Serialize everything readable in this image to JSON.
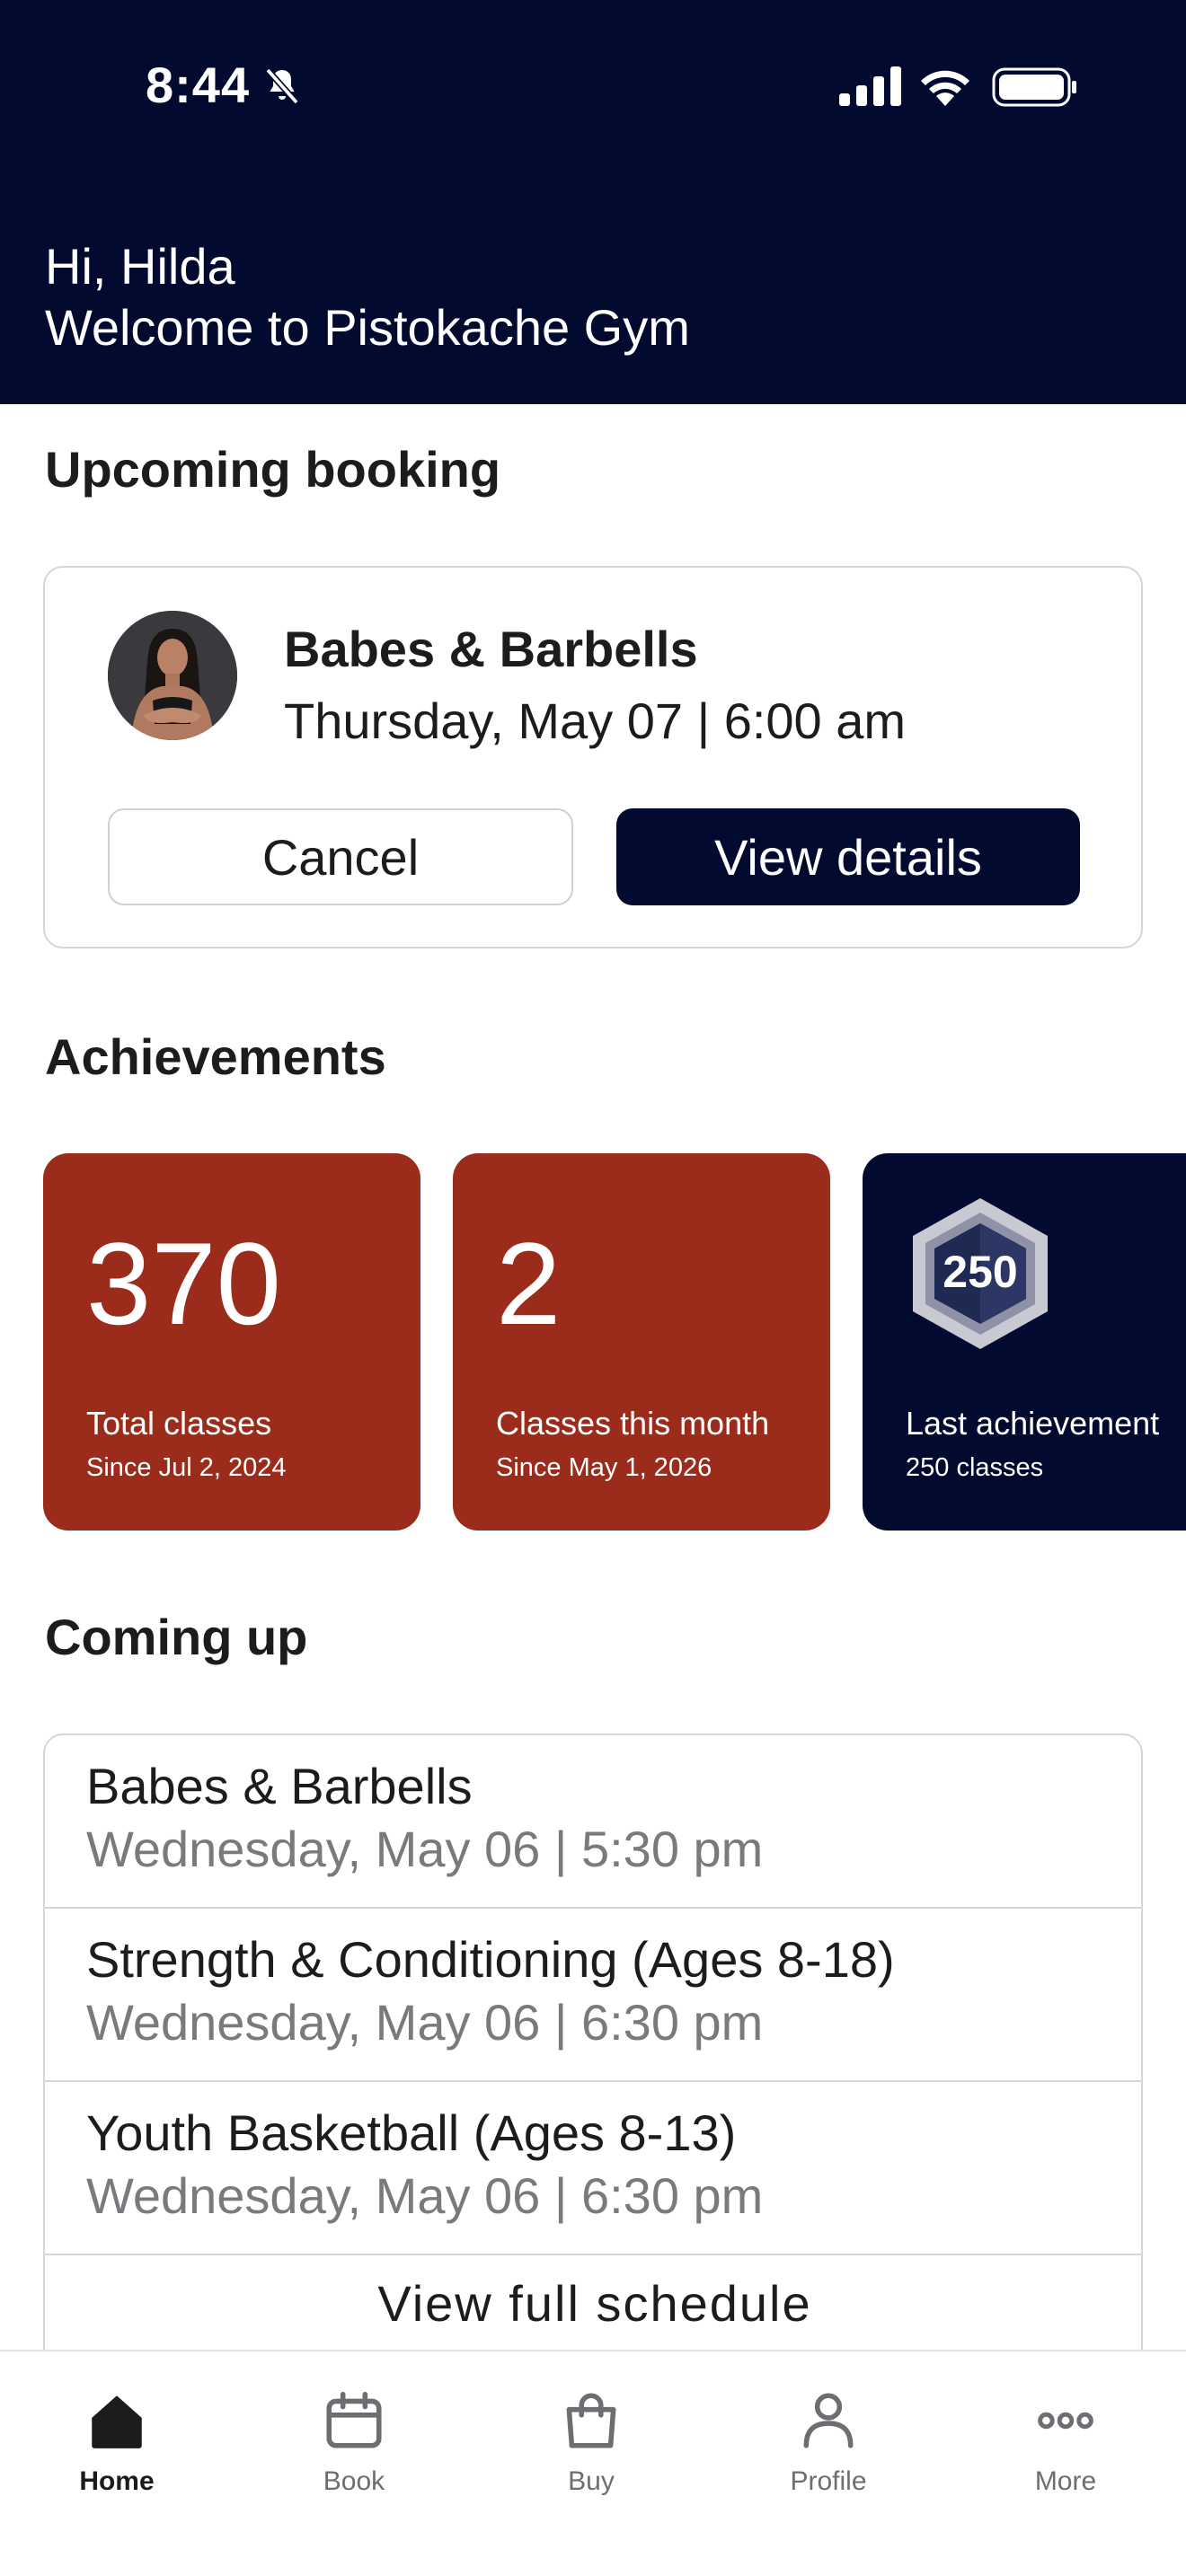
{
  "status_bar": {
    "time": "8:44"
  },
  "header": {
    "greeting": "Hi, Hilda",
    "welcome": "Welcome to Pistokache Gym"
  },
  "upcoming": {
    "section_title": "Upcoming booking",
    "class_name": "Babes & Barbells",
    "datetime": "Thursday, May 07 | 6:00 am",
    "cancel_label": "Cancel",
    "view_label": "View details"
  },
  "achievements": {
    "section_title": "Achievements",
    "cards": [
      {
        "value": "370",
        "label": "Total classes",
        "sub": "Since Jul 2, 2024"
      },
      {
        "value": "2",
        "label": "Classes this month",
        "sub": "Since May 1, 2026"
      },
      {
        "badge": "250",
        "label": "Last achievement",
        "sub": "250 classes"
      }
    ]
  },
  "coming_up": {
    "section_title": "Coming up",
    "items": [
      {
        "title": "Babes & Barbells",
        "time": "Wednesday, May 06 | 5:30 pm"
      },
      {
        "title": "Strength & Conditioning (Ages 8-18)",
        "time": "Wednesday, May 06 | 6:30 pm"
      },
      {
        "title": "Youth Basketball (Ages 8-13)",
        "time": "Wednesday, May 06 | 6:30 pm"
      }
    ],
    "view_full_label": "View full schedule"
  },
  "tabbar": {
    "items": [
      {
        "label": "Home",
        "icon": "home-icon",
        "active": true
      },
      {
        "label": "Book",
        "icon": "calendar-icon"
      },
      {
        "label": "Buy",
        "icon": "shopping-bag-icon"
      },
      {
        "label": "Profile",
        "icon": "person-icon"
      },
      {
        "label": "More",
        "icon": "more-dots-icon"
      }
    ]
  },
  "colors": {
    "navy": "#030a2f",
    "accent_red": "#9b2b1a",
    "muted_text": "#7a7a7e"
  }
}
